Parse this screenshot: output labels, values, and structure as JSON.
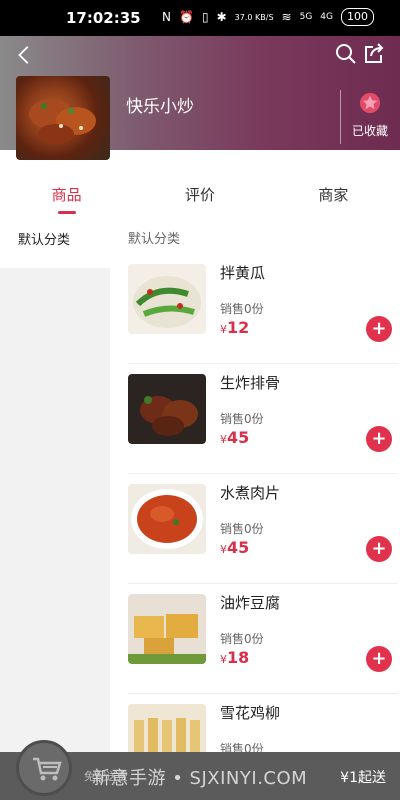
{
  "status_bar": {
    "time": "17:02:35",
    "network_speed": "37.0 KB/S",
    "signal_labels": [
      "5G",
      "4G"
    ],
    "battery": "100"
  },
  "shop": {
    "name": "快乐小炒",
    "favorite_label": "已收藏"
  },
  "tabs": [
    {
      "label": "商品",
      "active": true
    },
    {
      "label": "评价",
      "active": false
    },
    {
      "label": "商家",
      "active": false
    }
  ],
  "sidebar": {
    "items": [
      {
        "label": "默认分类"
      }
    ]
  },
  "menu": {
    "category_title": "默认分类",
    "items": [
      {
        "name": "拌黄瓜",
        "sales": "销售0份",
        "currency": "¥",
        "price": "12"
      },
      {
        "name": "生炸排骨",
        "sales": "销售0份",
        "currency": "¥",
        "price": "45"
      },
      {
        "name": "水煮肉片",
        "sales": "销售0份",
        "currency": "¥",
        "price": "45"
      },
      {
        "name": "油炸豆腐",
        "sales": "销售0份",
        "currency": "¥",
        "price": "18"
      },
      {
        "name": "雪花鸡柳",
        "sales": "销售0份",
        "currency": "¥",
        "price": ""
      }
    ]
  },
  "cart": {
    "hint": "免配送费",
    "min_order": "¥1起送"
  },
  "watermark": "新意手游 • SJXINYI.COM",
  "colors": {
    "accent": "#d9304a",
    "header_gradient_end": "#6e2c50",
    "cart_bar": "#5b5b5b"
  }
}
